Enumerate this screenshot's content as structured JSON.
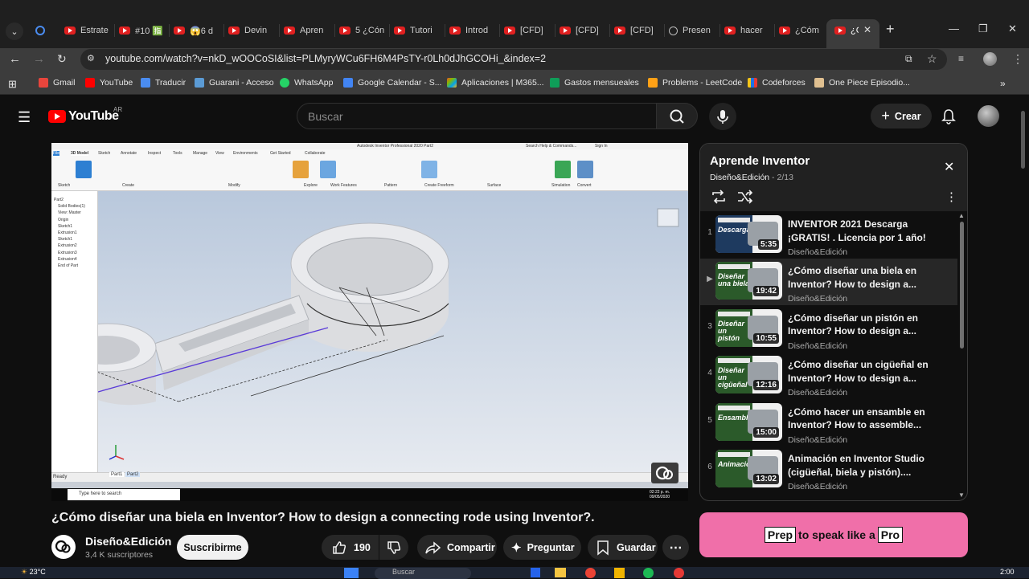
{
  "browser": {
    "tabs": [
      {
        "label": "Estrate",
        "icon": "youtube-icon"
      },
      {
        "label": "#10 🈯",
        "icon": "youtube-icon"
      },
      {
        "label": "😱6 d",
        "icon": "youtube-icon"
      },
      {
        "label": "Devin",
        "icon": "youtube-icon"
      },
      {
        "label": "Apren",
        "icon": "youtube-icon"
      },
      {
        "label": "5 ¿Cón",
        "icon": "youtube-icon"
      },
      {
        "label": "Tutori",
        "icon": "youtube-icon"
      },
      {
        "label": "Introd",
        "icon": "youtube-icon"
      },
      {
        "label": "[CFD]",
        "icon": "youtube-icon"
      },
      {
        "label": "[CFD]",
        "icon": "youtube-icon"
      },
      {
        "label": "[CFD]",
        "icon": "youtube-icon"
      },
      {
        "label": "Presen",
        "icon": "globe-icon"
      },
      {
        "label": "hacer",
        "icon": "youtube-icon"
      },
      {
        "label": "¿Cóm",
        "icon": "youtube-icon"
      },
      {
        "label": "¿C",
        "icon": "youtube-icon"
      }
    ],
    "url": "youtube.com/watch?v=nkD_wOOCoSI&list=PLMyryWCu6FH6M4PsTY-r0Lh0dJhGCOHi_&index=2",
    "bookmarks": [
      "Gmail",
      "YouTube",
      "Traducir",
      "Guarani - Acceso",
      "WhatsApp",
      "Google Calendar - S...",
      "Aplicaciones | M365...",
      "Gastos mensueales",
      "Problems - LeetCode",
      "Codeforces",
      "One Piece Episodio..."
    ]
  },
  "youtube": {
    "logo_text": "YouTube",
    "region": "AR",
    "search_placeholder": "Buscar",
    "create_label": "Crear"
  },
  "video": {
    "title": "¿Cómo diseñar una biela en Inventor? How to design a connecting rode using Inventor?.",
    "channel": "Diseño&Edición",
    "subscribers": "3,4 K suscriptores",
    "subscribe_label": "Suscribirme",
    "likes": "190",
    "share_label": "Compartir",
    "ask_label": "Preguntar",
    "save_label": "Guardar",
    "frame": {
      "app_title": "Autodesk Inventor Professional 2020   Part2",
      "help_search": "Search Help & Commands...",
      "sign_in": "Sign In",
      "ribbon_tabs": [
        "File",
        "3D Model",
        "Sketch",
        "Annotate",
        "Inspect",
        "Tools",
        "Manage",
        "View",
        "Environments",
        "Get Started",
        "Collaborate"
      ],
      "ribbon_groups": [
        "Sketch",
        "Create",
        "Modify",
        "Explore",
        "Work Features",
        "Pattern",
        "Create Freeform",
        "Surface",
        "Simulation",
        "Convert"
      ],
      "tree": [
        "Part2",
        "Solid Bodies(1)",
        "View: Master",
        "Origin",
        "Sketch1",
        "Extrusion1",
        "Sketch1",
        "Extrusion2",
        "Extrusion3",
        "Extrusion4",
        "End of Part"
      ],
      "status": "Ready",
      "taskbar_search": "Type here to search",
      "clock": "02:22 p. m. 09/05/2020",
      "doc_tabs": [
        "Part1",
        "Part2"
      ]
    }
  },
  "playlist": {
    "title": "Aprende Inventor",
    "channel": "Diseño&Edición",
    "position": "2/13",
    "items": [
      {
        "index": "1",
        "title": "INVENTOR 2021 Descarga ¡GRATIS! . Licencia por 1 año!",
        "channel": "Diseño&Edición",
        "duration": "5:35",
        "thumb_word": "Descarga"
      },
      {
        "index": "▶",
        "title": "¿Cómo diseñar una biela en Inventor? How to design a...",
        "channel": "Diseño&Edición",
        "duration": "19:42",
        "thumb_word": "Diseñar una biela"
      },
      {
        "index": "3",
        "title": "¿Cómo diseñar un pistón en Inventor? How to design a...",
        "channel": "Diseño&Edición",
        "duration": "10:55",
        "thumb_word": "Diseñar un pistón"
      },
      {
        "index": "4",
        "title": "¿Cómo diseñar un cigüeñal en Inventor? How to design a...",
        "channel": "Diseño&Edición",
        "duration": "12:16",
        "thumb_word": "Diseñar un cigüeñal"
      },
      {
        "index": "5",
        "title": "¿Cómo hacer un ensamble en Inventor? How to assemble...",
        "channel": "Diseño&Edición",
        "duration": "15:00",
        "thumb_word": "Ensamble"
      },
      {
        "index": "6",
        "title": "Animación en Inventor Studio (cigüeñal, biela y pistón)....",
        "channel": "Diseño&Edición",
        "duration": "13:02",
        "thumb_word": "Animación"
      }
    ]
  },
  "ad": {
    "text_before": "Prep",
    "text_middle": "to speak like a",
    "text_after": "Pro"
  },
  "os": {
    "temperature": "23°C",
    "time": "2:00",
    "search": "Buscar"
  },
  "colors": {
    "accent_red": "#ff0000",
    "ad_pink": "#f06fa9",
    "bg": "#0f0f0f"
  }
}
